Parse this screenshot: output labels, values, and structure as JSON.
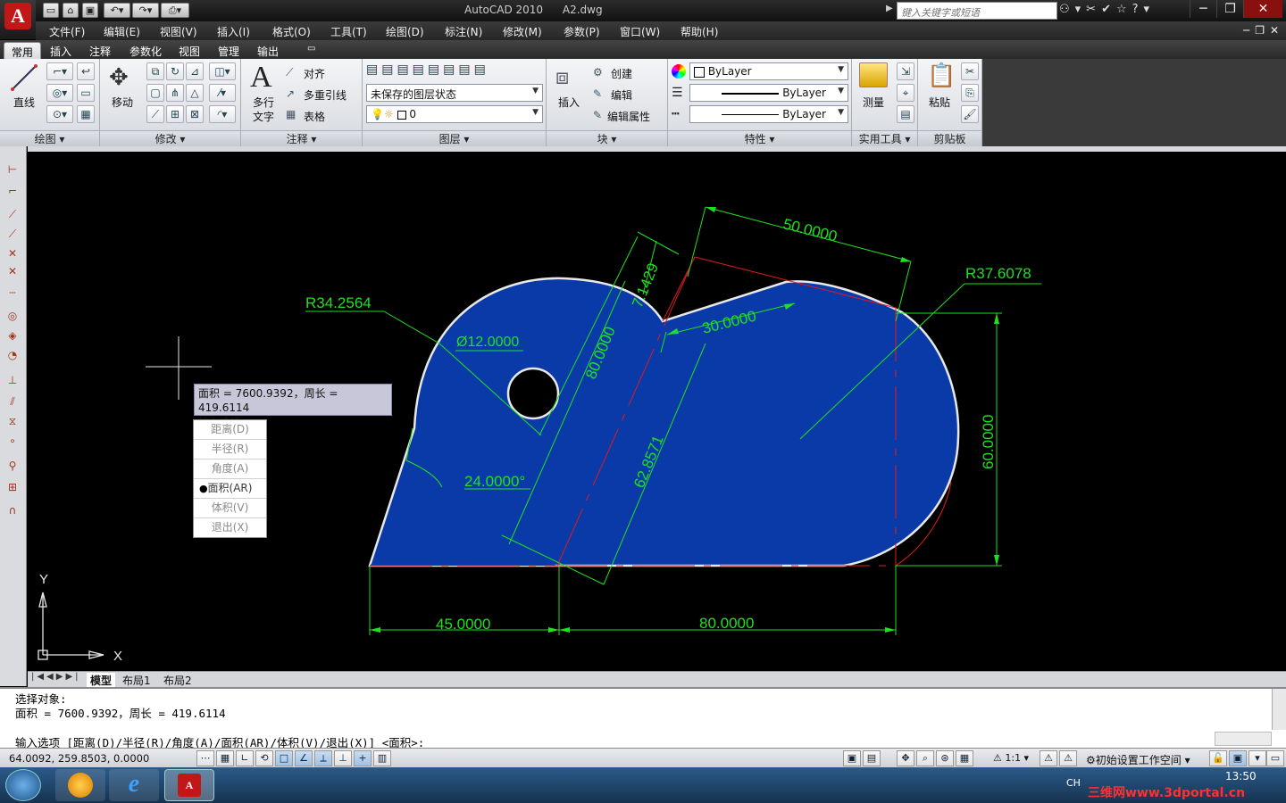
{
  "app": {
    "title": "AutoCAD 2010",
    "document": "A2.dwg",
    "search_placeholder": "键入关键字或短语",
    "logo_letter": "A"
  },
  "menus": [
    "文件(F)",
    "编辑(E)",
    "视图(V)",
    "插入(I)",
    "格式(O)",
    "工具(T)",
    "绘图(D)",
    "标注(N)",
    "修改(M)",
    "参数(P)",
    "窗口(W)",
    "帮助(H)"
  ],
  "ribbon_tabs": [
    "常用",
    "插入",
    "注释",
    "参数化",
    "视图",
    "管理",
    "输出"
  ],
  "ribbon": {
    "draw": {
      "title": "绘图",
      "line_label": "直线"
    },
    "modify": {
      "title": "修改",
      "move_label": "移动"
    },
    "annotation": {
      "title": "注释",
      "mtext_label1": "多行",
      "mtext_label2": "文字",
      "align_label": "对齐",
      "mleader_label": "多重引线",
      "table_label": "表格"
    },
    "layers": {
      "title": "图层",
      "state_combo": "未保存的图层状态",
      "layer_combo": "0"
    },
    "block": {
      "title": "块",
      "insert_label": "插入",
      "create_label": "创建",
      "edit_label": "编辑",
      "attr_label": "编辑属性"
    },
    "properties": {
      "title": "特性",
      "color": "ByLayer",
      "linetype": "ByLayer",
      "lineweight": "ByLayer"
    },
    "utilities": {
      "title": "实用工具",
      "measure_label": "测量"
    },
    "clipboard": {
      "title": "剪贴板",
      "paste_label": "粘贴"
    }
  },
  "layout_tabs": [
    "模型",
    "布局1",
    "布局2"
  ],
  "drawing": {
    "dims": {
      "r_left": "R34.2564",
      "dia": "Ø12.0000",
      "d80_diag": "80.0000",
      "d7": "7.1429",
      "d50": "50.0000",
      "d30": "30.0000",
      "r_right": "R37.6078",
      "d62": "62.8571",
      "angle": "24.0000°",
      "d60": "60.0000",
      "d45": "45.0000",
      "d80_bottom": "80.0000"
    },
    "ucs_x": "X",
    "ucs_y": "Y",
    "fill_color": "#0a3aa8",
    "dim_color": "#1fe01f",
    "center_color": "#e01b1b"
  },
  "tooltip": {
    "line1": "面积 = 7600.9392，周长 = 419.6114",
    "line2": "输入选项"
  },
  "options": [
    {
      "label": "距离(D)",
      "selected": false
    },
    {
      "label": "半径(R)",
      "selected": false
    },
    {
      "label": "角度(A)",
      "selected": false
    },
    {
      "label": "面积(AR)",
      "selected": true
    },
    {
      "label": "体积(V)",
      "selected": false
    },
    {
      "label": "退出(X)",
      "selected": false
    }
  ],
  "command": {
    "line1": "选择对象:",
    "line2": "面积 = 7600.9392，周长 = 419.6114",
    "line3": "输入选项 [距离(D)/半径(R)/角度(A)/面积(AR)/体积(V)/退出(X)] <面积>:"
  },
  "status": {
    "coords": "64.0092,   259.8503,  0.0000",
    "scale": "1:1",
    "workspace": "初始设置工作空间"
  },
  "taskbar": {
    "ime": "CH",
    "time": "13:50",
    "watermark": "三维网www.3dportal.cn"
  }
}
